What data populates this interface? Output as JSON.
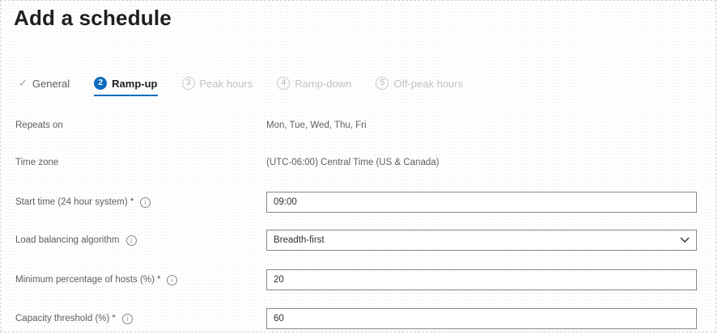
{
  "page": {
    "title": "Add a schedule"
  },
  "steps": [
    {
      "label": "General",
      "status": "done",
      "icon": "checkmark-icon"
    },
    {
      "label": "Ramp-up",
      "status": "active",
      "number": "2"
    },
    {
      "label": "Peak hours",
      "status": "pending",
      "number": "3"
    },
    {
      "label": "Ramp-down",
      "status": "pending",
      "number": "4"
    },
    {
      "label": "Off-peak hours",
      "status": "pending",
      "number": "5"
    }
  ],
  "form": {
    "repeats_on": {
      "label": "Repeats on",
      "value": "Mon, Tue, Wed, Thu, Fri"
    },
    "time_zone": {
      "label": "Time zone",
      "value": "(UTC-06:00) Central Time (US & Canada)"
    },
    "start_time": {
      "label": "Start time (24 hour system)",
      "required": "*",
      "value": "09:00"
    },
    "load_balancing": {
      "label": "Load balancing algorithm",
      "value": "Breadth-first",
      "icon": "chevron-down-icon"
    },
    "min_hosts": {
      "label": "Minimum percentage of hosts (%)",
      "required": "*",
      "value": "20"
    },
    "capacity": {
      "label": "Capacity threshold (%)",
      "required": "*",
      "value": "60"
    }
  },
  "info_glyph": "i",
  "colors": {
    "accent": "#0f6cbd",
    "text": "#323130",
    "muted": "#605e5c",
    "border": "#8a8886"
  }
}
